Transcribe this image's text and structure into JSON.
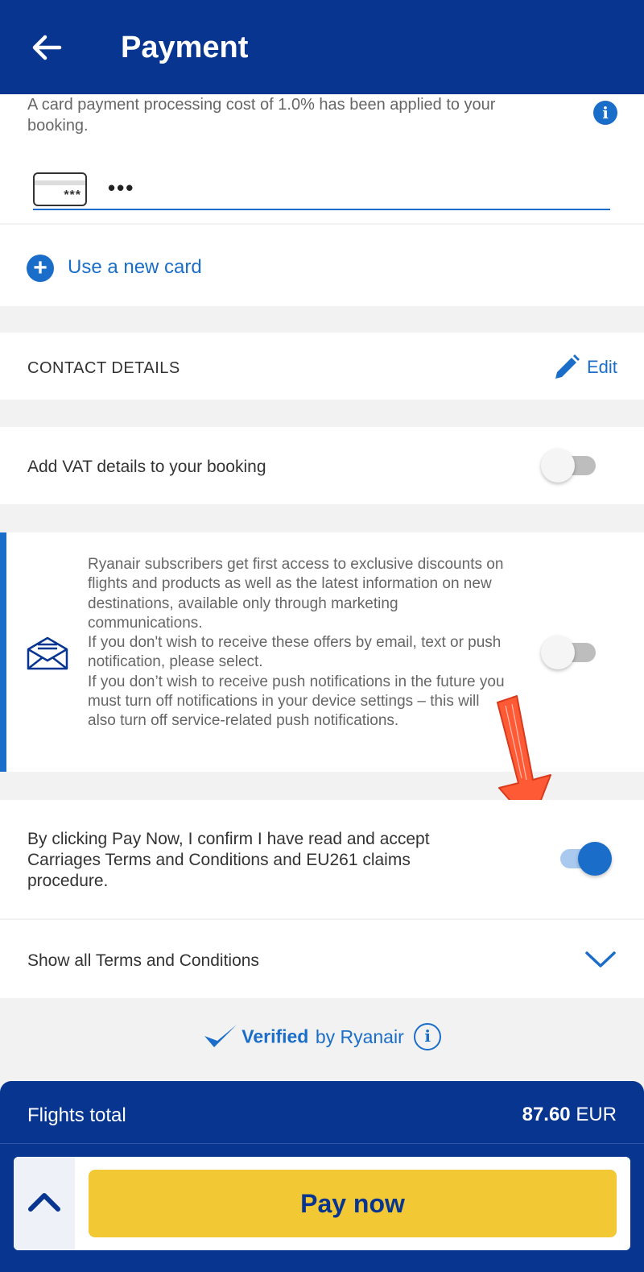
{
  "header": {
    "title": "Payment"
  },
  "payment": {
    "fee_notice": "A card payment processing cost of 1.0% has been applied to your booking.",
    "card_icon_stars": "***",
    "card_masked": "•••",
    "use_new_card": "Use a new card"
  },
  "contact": {
    "label": "CONTACT DETAILS",
    "edit": "Edit"
  },
  "vat": {
    "label": "Add VAT details to your booking",
    "enabled": false
  },
  "marketing": {
    "text": "Ryanair subscribers get first access to exclusive discounts on flights and products as well as the latest information on new destinations, available only through marketing communications.\nIf you don't wish to receive these offers by email, text or push notification, please select.\nIf you don’t wish to receive push notifications in the future you must turn off notifications in your device settings – this will also turn off service-related push notifications.",
    "enabled": false
  },
  "terms": {
    "consent": "By clicking Pay Now, I confirm I have read and accept Carriages Terms and Conditions and EU261 claims procedure.",
    "consent_enabled": true,
    "show_all": "Show all Terms and Conditions"
  },
  "verified": {
    "bold": "Verified",
    "rest": "by Ryanair"
  },
  "footer": {
    "total_label": "Flights total",
    "total_value": "87.60",
    "currency": "EUR",
    "pay_label": "Pay now"
  },
  "colors": {
    "header_bg": "#073590",
    "accent": "#1a6dc8",
    "pay_button": "#f2c935",
    "annotation_arrow": "#ff5a36"
  },
  "icons": [
    "back-arrow-icon",
    "info-icon",
    "card-icon",
    "plus-icon",
    "pencil-icon",
    "envelope-icon",
    "chevron-down-icon",
    "verified-check-icon",
    "chevron-up-icon"
  ]
}
